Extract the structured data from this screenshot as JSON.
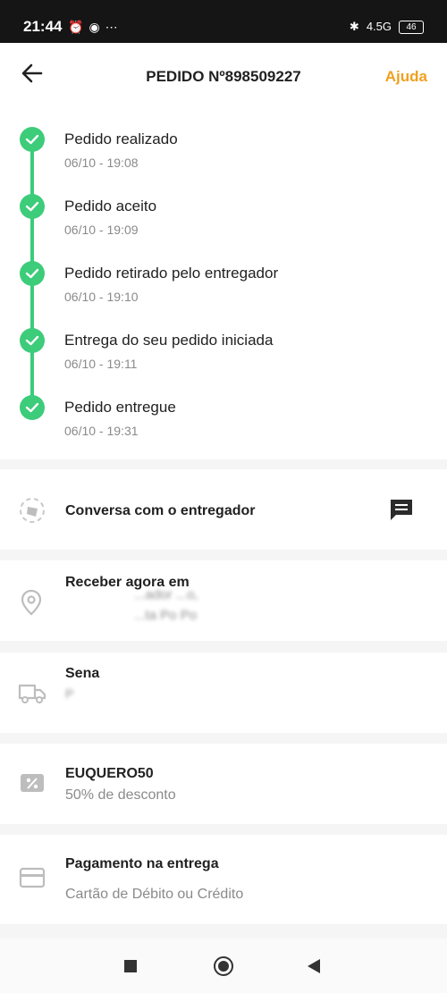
{
  "status_bar": {
    "time": "21:44",
    "icons": [
      "alarm-icon",
      "spotify-icon",
      "signal-icon",
      "wifi-icon",
      "more-icon"
    ],
    "network": "4.5G",
    "battery": "46"
  },
  "header": {
    "title": "PEDIDO Nº898509227",
    "help": "Ajuda",
    "help_color": "#f0a020"
  },
  "timeline": {
    "accent": "#3ccc7a",
    "steps": [
      {
        "title": "Pedido realizado",
        "time": "06/10 - 19:08"
      },
      {
        "title": "Pedido aceito",
        "time": "06/10 - 19:09"
      },
      {
        "title": "Pedido retirado pelo entregador",
        "time": "06/10 - 19:10"
      },
      {
        "title": "Entrega do seu pedido iniciada",
        "time": "06/10 - 19:11"
      },
      {
        "title": "Pedido entregue",
        "time": "06/10 - 19:31"
      }
    ]
  },
  "chat": {
    "label": "Conversa com o entregador"
  },
  "address": {
    "title": "Receber agora em",
    "line1": "...ador ...o,",
    "line2": "...ta Po Po"
  },
  "store": {
    "title": "Sena",
    "line1": "P"
  },
  "coupon": {
    "title": "EUQUERO50",
    "subtitle": "50% de desconto"
  },
  "payment": {
    "title": "Pagamento na entrega",
    "subtitle": "Cartão de Débito ou Crédito"
  }
}
